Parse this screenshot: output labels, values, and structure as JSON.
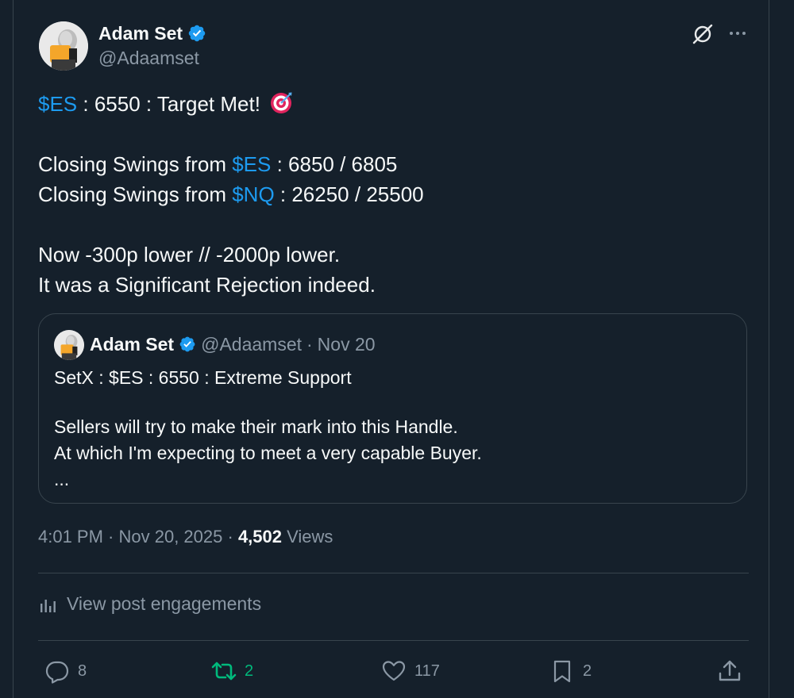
{
  "author": {
    "display_name": "Adam Set",
    "handle": "@Adaamset",
    "verified": true
  },
  "header_icons": {
    "grok": "grok-icon",
    "more": "more-icon"
  },
  "tweet": {
    "lines": [
      {
        "cashtag": "$ES",
        "text": " : 6550 : Target Met! ",
        "emoji": "direct-hit-emoji"
      },
      {
        "blank": true
      },
      {
        "prefix": "Closing Swings from ",
        "cashtag": "$ES",
        "text": " : 6850 / 6805"
      },
      {
        "prefix": "Closing Swings from ",
        "cashtag": "$NQ",
        "text": " : 26250 / 25500"
      },
      {
        "blank": true
      },
      {
        "text": "Now -300p lower // -2000p lower."
      },
      {
        "text": "It was a Significant Rejection indeed."
      }
    ],
    "line1_cashtag": "$ES",
    "line1_text": " : 6550 : Target Met! ",
    "line3_prefix": "Closing Swings from ",
    "line3_cashtag": "$ES",
    "line3_text": " : 6850 / 6805",
    "line4_prefix": "Closing Swings from ",
    "line4_cashtag": "$NQ",
    "line4_text": " : 26250 / 25500",
    "line6_text": "Now -300p lower // -2000p lower.",
    "line7_text": "It was a Significant Rejection indeed."
  },
  "quote": {
    "display_name": "Adam Set",
    "handle": "@Adaamset",
    "separator": "·",
    "date": "Nov 20",
    "line1": "SetX : $ES : 6550 : Extreme Support",
    "line2": "Sellers will try to make their mark into this Handle.",
    "line3": "At which I'm expecting to meet a very capable Buyer.",
    "line4": "..."
  },
  "meta": {
    "time": "4:01 PM",
    "separator": " · ",
    "date": "Nov 20, 2025",
    "separator2": " · ",
    "views_count": "4,502",
    "views_label": " Views"
  },
  "engagements_label": "View post engagements",
  "actions": {
    "replies": "8",
    "reposts": "2",
    "likes": "117",
    "bookmarks": "2"
  },
  "colors": {
    "background": "#15202b",
    "border": "#38444d",
    "text": "#f7f9f9",
    "muted": "#8b98a5",
    "link": "#1d9bf0",
    "repost_active": "#00ba7c",
    "verified": "#1d9bf0"
  }
}
